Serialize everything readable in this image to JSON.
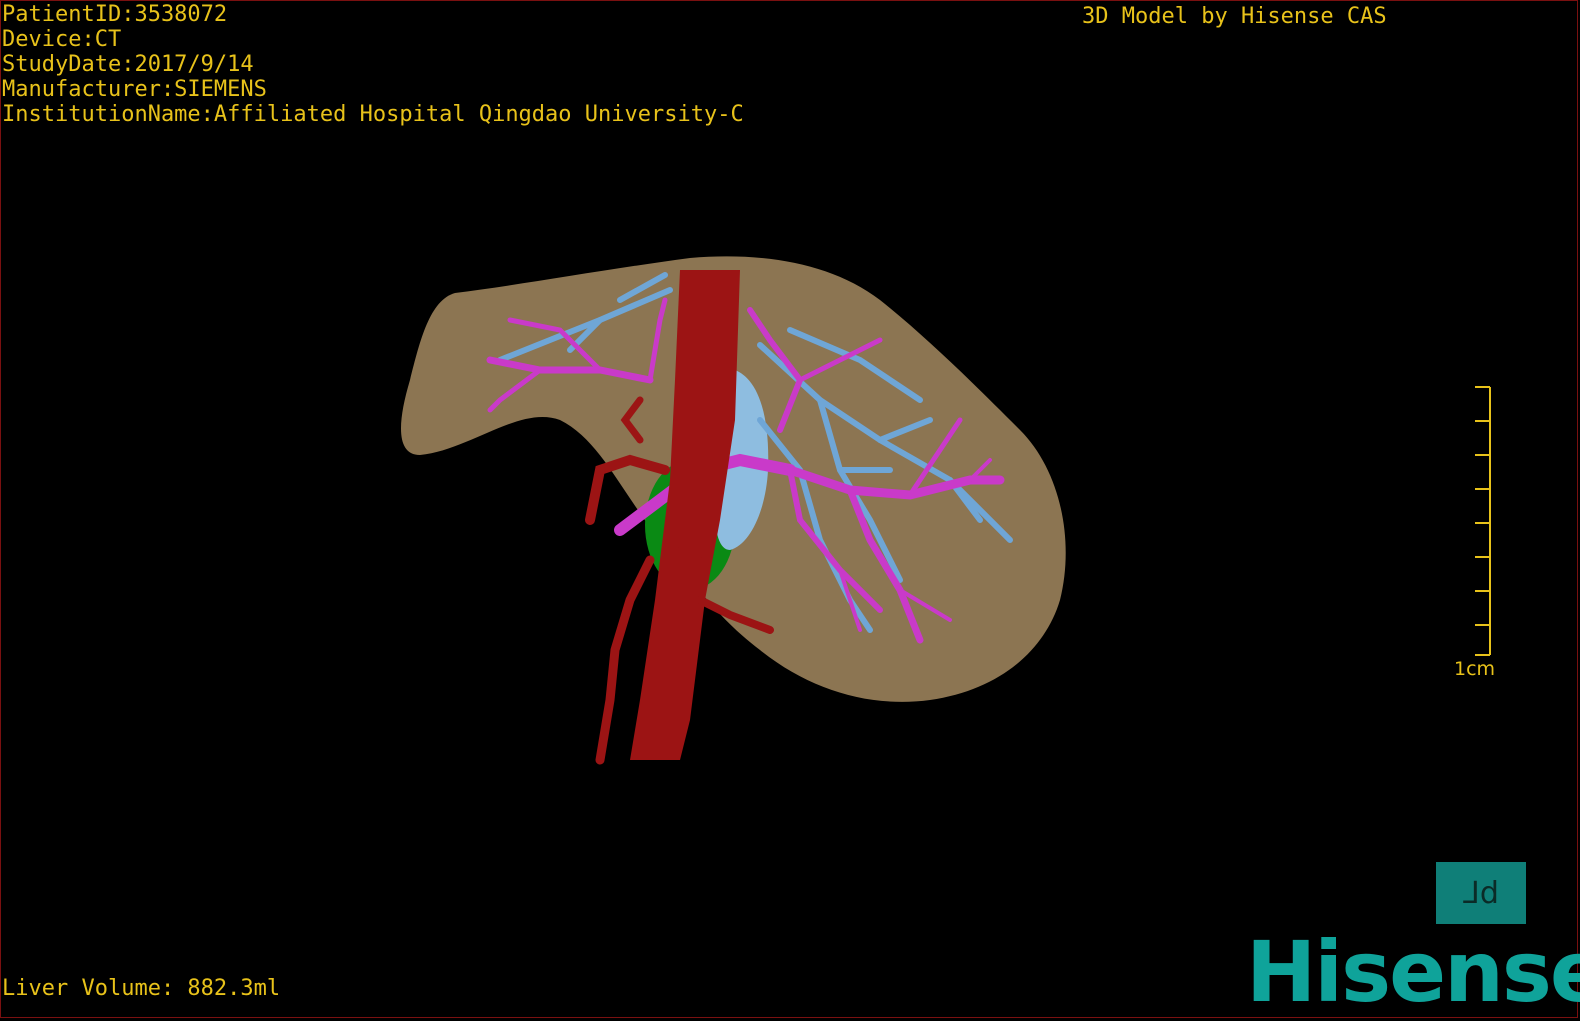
{
  "header": {
    "patient_id": "PatientID:3538072",
    "device": "Device:CT",
    "study_date": "StudyDate:2017/9/14",
    "manufacturer": "Manufacturer:SIEMENS",
    "institution": "InstitutionName:Affiliated Hospital Qingdao University-C",
    "credit": "3D Model by Hisense CAS"
  },
  "footer": {
    "liver_volume": "Liver Volume: 882.3ml"
  },
  "scale_bar": {
    "label": "1cm"
  },
  "orientation_marker": {
    "left_glyph": "L",
    "right_glyph": "d"
  },
  "brand": {
    "logo_text": "Hisense",
    "logo_color": "#0fa39a"
  },
  "colors": {
    "overlay_text": "#e8c21a",
    "liver": "#8c7552",
    "artery_cava": "#9c1414",
    "portal_vein": "#c93ac9",
    "hepatic_vein": "#6fa6d6",
    "tumor": "#8ebde0",
    "gallbladder": "#0a8a14"
  }
}
